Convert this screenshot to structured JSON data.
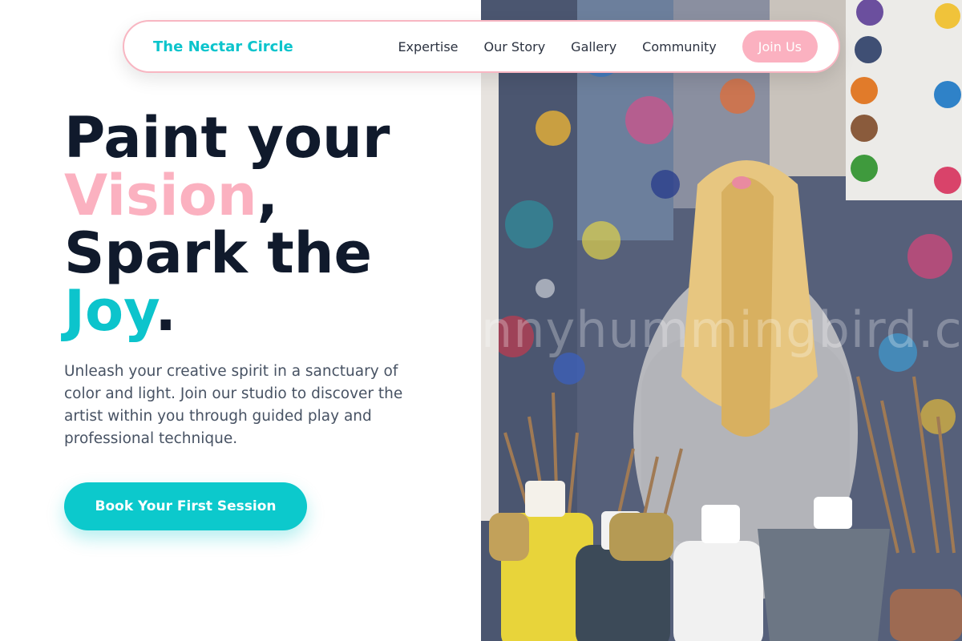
{
  "nav": {
    "brand": "The Nectar Circle",
    "links": [
      {
        "label": "Expertise"
      },
      {
        "label": "Our Story"
      },
      {
        "label": "Gallery"
      },
      {
        "label": "Community"
      }
    ],
    "join_label": "Join Us"
  },
  "hero": {
    "headline": {
      "line1": "Paint your",
      "vision": "Vision",
      "comma": ",",
      "line3": "Spark the",
      "joy": "Joy",
      "period": "."
    },
    "lede": "Unleash your creative spirit in a sanctuary of color and light. Join our studio to discover the artist within you through guided play and professional technique.",
    "cta_label": "Book Your First Session"
  },
  "photo": {
    "watermark": "nnyhummingbird.co"
  },
  "colors": {
    "brand_teal": "#0cc4cc",
    "accent_pink": "#fbb1c0",
    "headline_navy": "#101a2c"
  }
}
